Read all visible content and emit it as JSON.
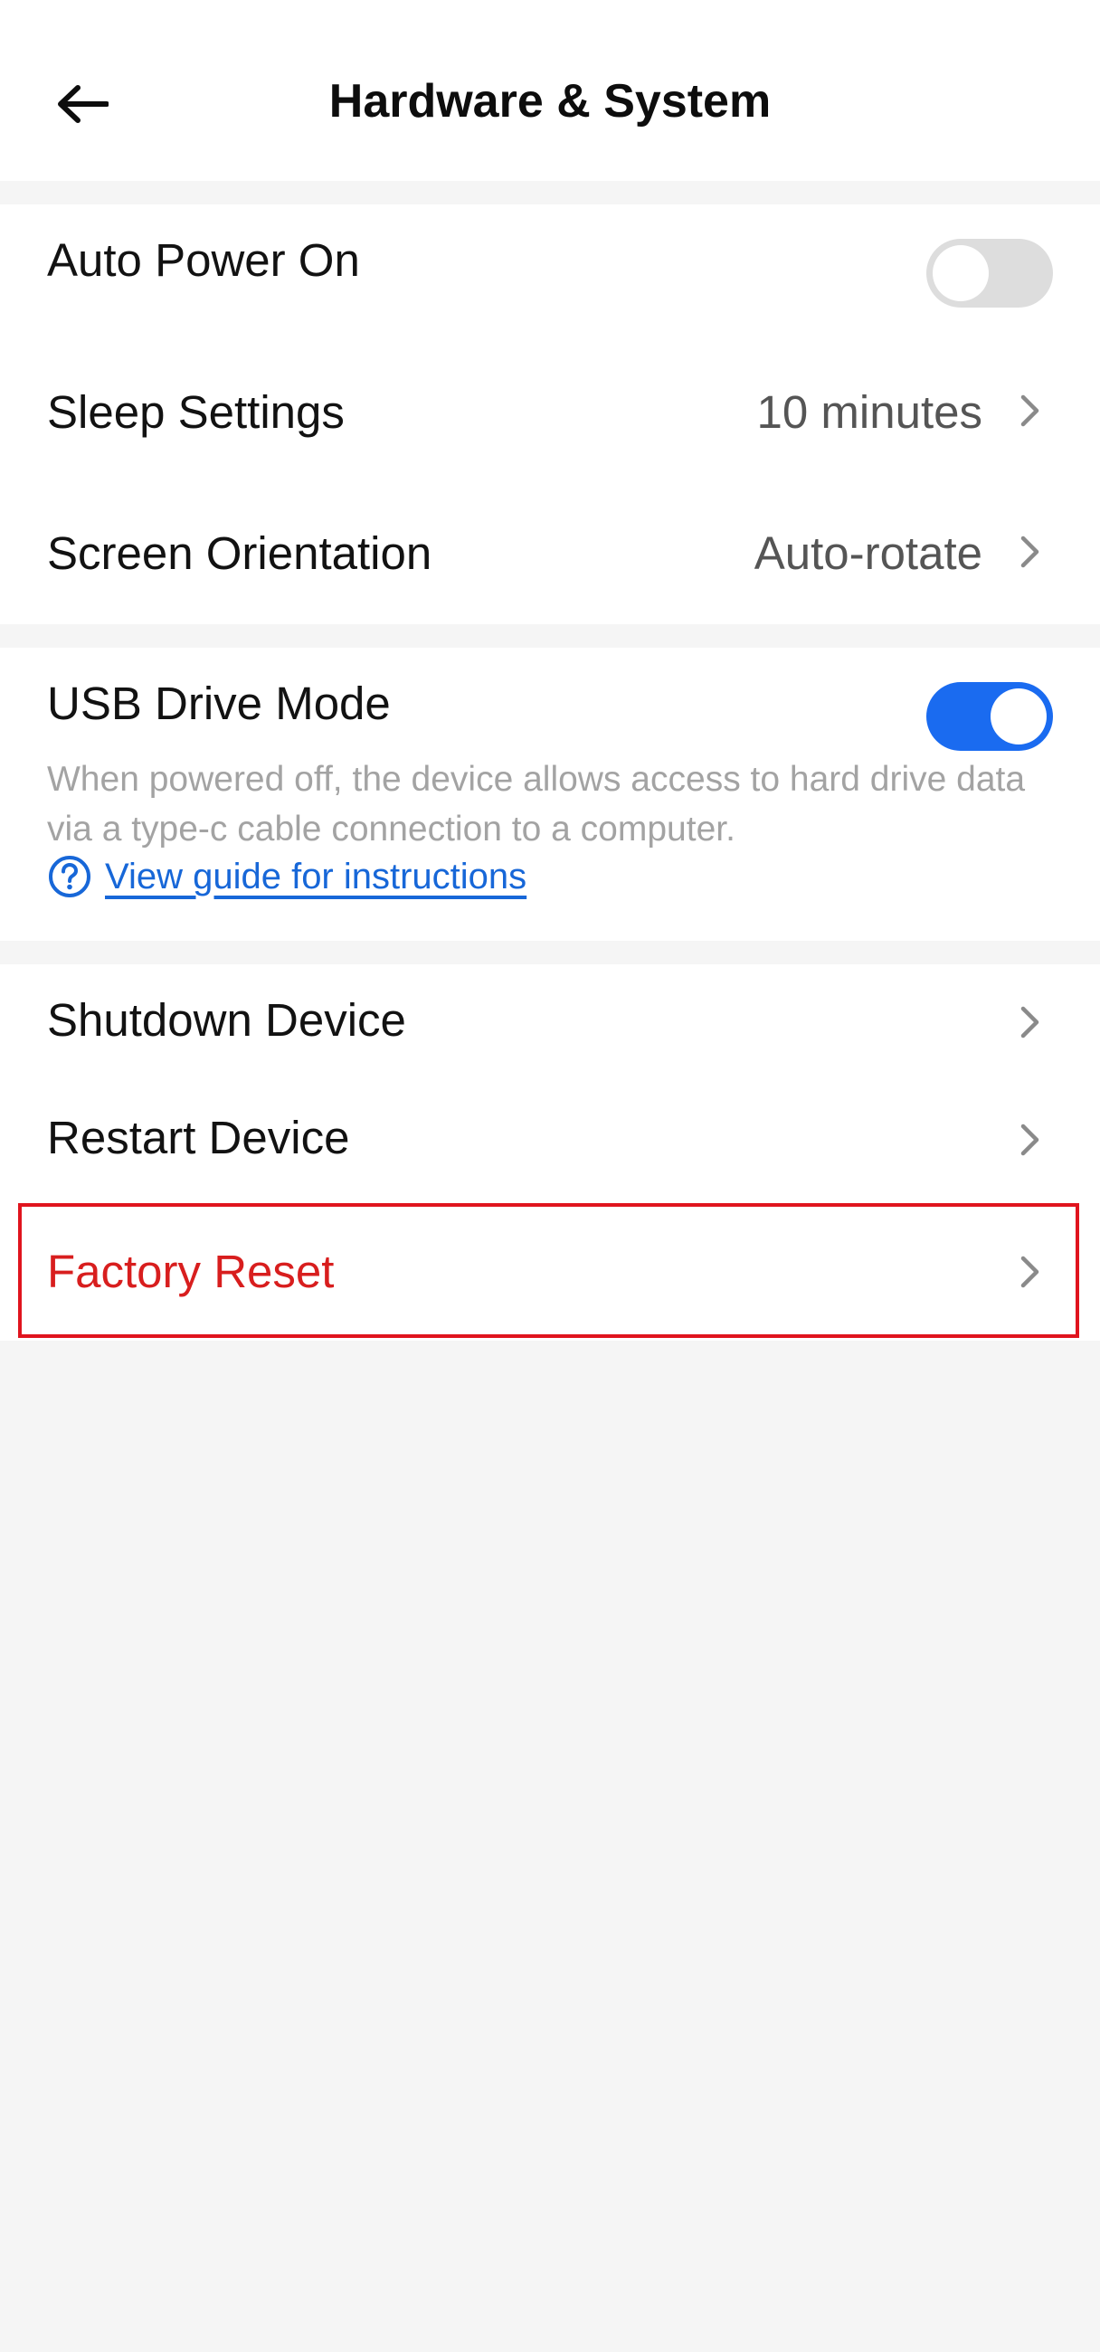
{
  "header": {
    "title": "Hardware & System",
    "back_icon": "arrow-left-icon"
  },
  "colors": {
    "background": "#f5f5f5",
    "card": "#ffffff",
    "accent_blue": "#1a6bf0",
    "link_blue": "#1767d8",
    "danger_red": "#d81e1e",
    "toggle_off": "#dddddd",
    "description_gray": "#a3a3a3"
  },
  "power_section": {
    "auto_power_on": {
      "label": "Auto Power On",
      "toggle_on": false
    },
    "sleep_settings": {
      "label": "Sleep Settings",
      "value": "10 minutes",
      "icon": "chevron-right-icon"
    },
    "screen_orientation": {
      "label": "Screen Orientation",
      "value": "Auto-rotate",
      "icon": "chevron-right-icon"
    }
  },
  "usb_section": {
    "label": "USB Drive Mode",
    "toggle_on": true,
    "description": "When powered off, the device allows access to hard drive data via a type-c cable connection to a computer.",
    "guide_link": "View guide for instructions",
    "guide_icon": "help-circle-icon"
  },
  "device_section": {
    "shutdown": {
      "label": "Shutdown Device",
      "icon": "chevron-right-icon"
    },
    "restart": {
      "label": "Restart Device",
      "icon": "chevron-right-icon"
    },
    "factory_reset": {
      "label": "Factory Reset",
      "icon": "chevron-right-icon",
      "highlighted": true
    }
  }
}
